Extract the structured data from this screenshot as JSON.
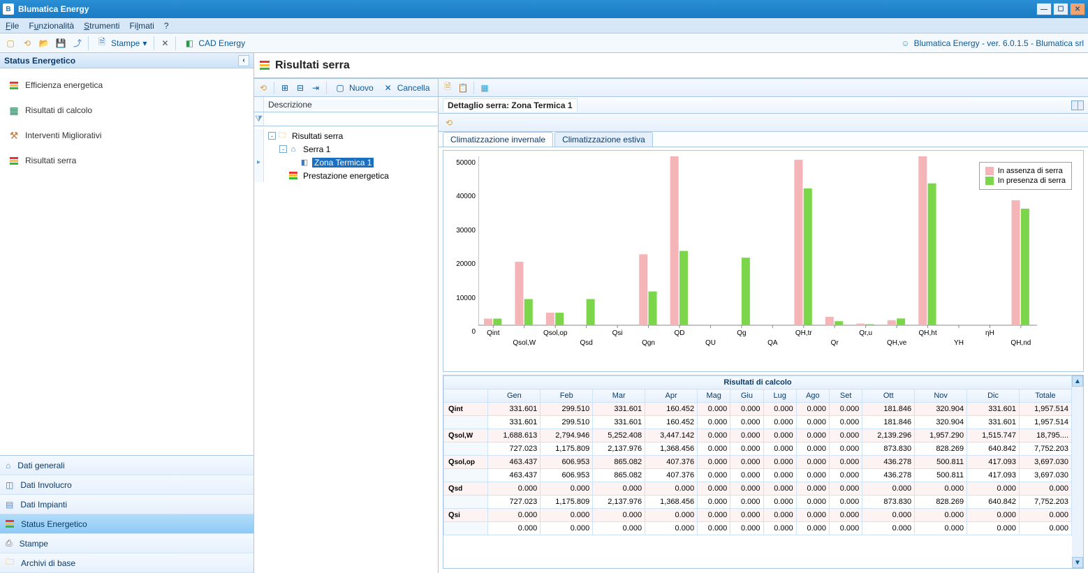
{
  "app": {
    "title": "Blumatica Energy"
  },
  "version_text": "Blumatica Energy - ver. 6.0.1.5 - Blumatica srl",
  "menubar": [
    "File",
    "Funzionalità",
    "Strumenti",
    "Filmati",
    "?"
  ],
  "toolbar": {
    "stampe": "Stampe",
    "cad": "CAD Energy"
  },
  "left": {
    "header": "Status Energetico",
    "items": [
      {
        "label": "Efficienza energetica",
        "icon": "bars"
      },
      {
        "label": "Risultati di calcolo",
        "icon": "calc"
      },
      {
        "label": "Interventi Migliorativi",
        "icon": "tool"
      },
      {
        "label": "Risultati serra",
        "icon": "bars"
      }
    ],
    "bottom": [
      {
        "label": "Dati generali",
        "icon": "home"
      },
      {
        "label": "Dati Involucro",
        "icon": "cube"
      },
      {
        "label": "Dati Impianti",
        "icon": "plant"
      },
      {
        "label": "Status Energetico",
        "icon": "bars",
        "selected": true
      },
      {
        "label": "Stampe",
        "icon": "print"
      },
      {
        "label": "Archivi di base",
        "icon": "folder"
      }
    ]
  },
  "page_title": "Risultati serra",
  "mid_toolbar": {
    "nuovo": "Nuovo",
    "cancella": "Cancella"
  },
  "desc_label": "Descrizione",
  "tree": [
    {
      "level": 0,
      "label": "Risultati serra",
      "exp": "-",
      "icon": "folder"
    },
    {
      "level": 1,
      "label": "Serra 1",
      "exp": "-",
      "icon": "house"
    },
    {
      "level": 2,
      "label": "Zona Termica 1",
      "exp": "",
      "icon": "zone",
      "selected": true
    },
    {
      "level": 1,
      "label": "Prestazione energetica",
      "exp": "",
      "icon": "bars"
    }
  ],
  "detail_title": "Dettaglio serra: Zona Termica 1",
  "tabs": [
    {
      "label": "Climatizzazione invernale",
      "active": true
    },
    {
      "label": "Climatizzazione estiva",
      "active": false
    }
  ],
  "chart_data": {
    "type": "bar",
    "categories": [
      "Qint",
      "Qsol,W",
      "Qsol,op",
      "Qsd",
      "Qsi",
      "Qgn",
      "QD",
      "QU",
      "Qg",
      "QA",
      "QH,tr",
      "Qr",
      "Qr,u",
      "QH,ve",
      "QH,ht",
      "YH",
      "ηH",
      "QH,nd"
    ],
    "series": [
      {
        "name": "In assenza di serra",
        "color": "#f5b4b7",
        "values": [
          1957,
          18795,
          3697,
          0,
          0,
          21000,
          50000,
          0,
          0,
          0,
          49000,
          2500,
          500,
          1500,
          51000,
          0,
          0,
          37000
        ]
      },
      {
        "name": "In presenza di serra",
        "color": "#7bd64a",
        "values": [
          1957,
          7752,
          3697,
          7752,
          0,
          10000,
          22000,
          0,
          20000,
          0,
          40500,
          1200,
          300,
          2000,
          42000,
          0,
          0,
          34500
        ]
      }
    ],
    "ylim": [
      0,
      50000
    ],
    "yticks": [
      0,
      10000,
      20000,
      30000,
      40000,
      50000
    ]
  },
  "table": {
    "title": "Risultati di calcolo",
    "columns": [
      "Gen",
      "Feb",
      "Mar",
      "Apr",
      "Mag",
      "Giu",
      "Lug",
      "Ago",
      "Set",
      "Ott",
      "Nov",
      "Dic",
      "Totale"
    ],
    "rows": [
      {
        "label": "Q",
        "sub": "int",
        "alt": true,
        "v": [
          "331.601",
          "299.510",
          "331.601",
          "160.452",
          "0.000",
          "0.000",
          "0.000",
          "0.000",
          "0.000",
          "181.846",
          "320.904",
          "331.601",
          "1,957.514"
        ]
      },
      {
        "label": "",
        "sub": "",
        "alt": false,
        "v": [
          "331.601",
          "299.510",
          "331.601",
          "160.452",
          "0.000",
          "0.000",
          "0.000",
          "0.000",
          "0.000",
          "181.846",
          "320.904",
          "331.601",
          "1,957.514"
        ]
      },
      {
        "label": "Q",
        "sub": "sol,W",
        "alt": true,
        "v": [
          "1,688.613",
          "2,794.946",
          "5,252.408",
          "3,447.142",
          "0.000",
          "0.000",
          "0.000",
          "0.000",
          "0.000",
          "2,139.296",
          "1,957.290",
          "1,515.747",
          "18,795...."
        ]
      },
      {
        "label": "",
        "sub": "",
        "alt": false,
        "v": [
          "727.023",
          "1,175.809",
          "2,137.976",
          "1,368.456",
          "0.000",
          "0.000",
          "0.000",
          "0.000",
          "0.000",
          "873.830",
          "828.269",
          "640.842",
          "7,752.203"
        ]
      },
      {
        "label": "Q",
        "sub": "sol,op",
        "alt": true,
        "v": [
          "463.437",
          "606.953",
          "865.082",
          "407.376",
          "0.000",
          "0.000",
          "0.000",
          "0.000",
          "0.000",
          "436.278",
          "500.811",
          "417.093",
          "3,697.030"
        ]
      },
      {
        "label": "",
        "sub": "",
        "alt": false,
        "v": [
          "463.437",
          "606.953",
          "865.082",
          "407.376",
          "0.000",
          "0.000",
          "0.000",
          "0.000",
          "0.000",
          "436.278",
          "500.811",
          "417.093",
          "3,697.030"
        ]
      },
      {
        "label": "Q",
        "sub": "sd",
        "alt": true,
        "v": [
          "0.000",
          "0.000",
          "0.000",
          "0.000",
          "0.000",
          "0.000",
          "0.000",
          "0.000",
          "0.000",
          "0.000",
          "0.000",
          "0.000",
          "0.000"
        ]
      },
      {
        "label": "",
        "sub": "",
        "alt": false,
        "v": [
          "727.023",
          "1,175.809",
          "2,137.976",
          "1,368.456",
          "0.000",
          "0.000",
          "0.000",
          "0.000",
          "0.000",
          "873.830",
          "828.269",
          "640.842",
          "7,752.203"
        ]
      },
      {
        "label": "Q",
        "sub": "si",
        "alt": true,
        "v": [
          "0.000",
          "0.000",
          "0.000",
          "0.000",
          "0.000",
          "0.000",
          "0.000",
          "0.000",
          "0.000",
          "0.000",
          "0.000",
          "0.000",
          "0.000"
        ]
      },
      {
        "label": "",
        "sub": "",
        "alt": false,
        "v": [
          "0.000",
          "0.000",
          "0.000",
          "0.000",
          "0.000",
          "0.000",
          "0.000",
          "0.000",
          "0.000",
          "0.000",
          "0.000",
          "0.000",
          "0.000"
        ]
      }
    ]
  }
}
